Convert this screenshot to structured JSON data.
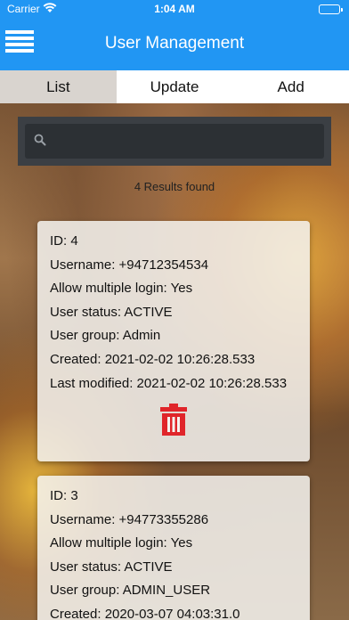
{
  "status_bar": {
    "carrier": "Carrier",
    "time": "1:04 AM",
    "wifi_icon": "wifi-icon",
    "battery_icon": "battery-icon"
  },
  "nav": {
    "title": "User Management",
    "menu_icon": "hamburger-menu-icon",
    "color": "#2196f3"
  },
  "tabs": [
    {
      "label": "List",
      "active": true
    },
    {
      "label": "Update",
      "active": false
    },
    {
      "label": "Add",
      "active": false
    }
  ],
  "search": {
    "value": "",
    "placeholder": "",
    "icon": "search-icon"
  },
  "results_text": "4 Results found",
  "users": [
    {
      "id": "ID: 4",
      "username": "Username: +94712354534",
      "multiple_login": "Allow multiple login: Yes",
      "status": "User status: ACTIVE",
      "group": "User group: Admin",
      "created": "Created: 2021-02-02 10:26:28.533",
      "modified": "Last modified: 2021-02-02 10:26:28.533",
      "delete_icon": "trash-icon"
    },
    {
      "id": "ID: 3",
      "username": "Username: +94773355286",
      "multiple_login": "Allow multiple login: Yes",
      "status": "User status: ACTIVE",
      "group": "User group: ADMIN_USER",
      "created": "Created: 2020-03-07 04:03:31.0"
    }
  ],
  "colors": {
    "accent": "#2196f3",
    "delete": "#e0252a"
  }
}
